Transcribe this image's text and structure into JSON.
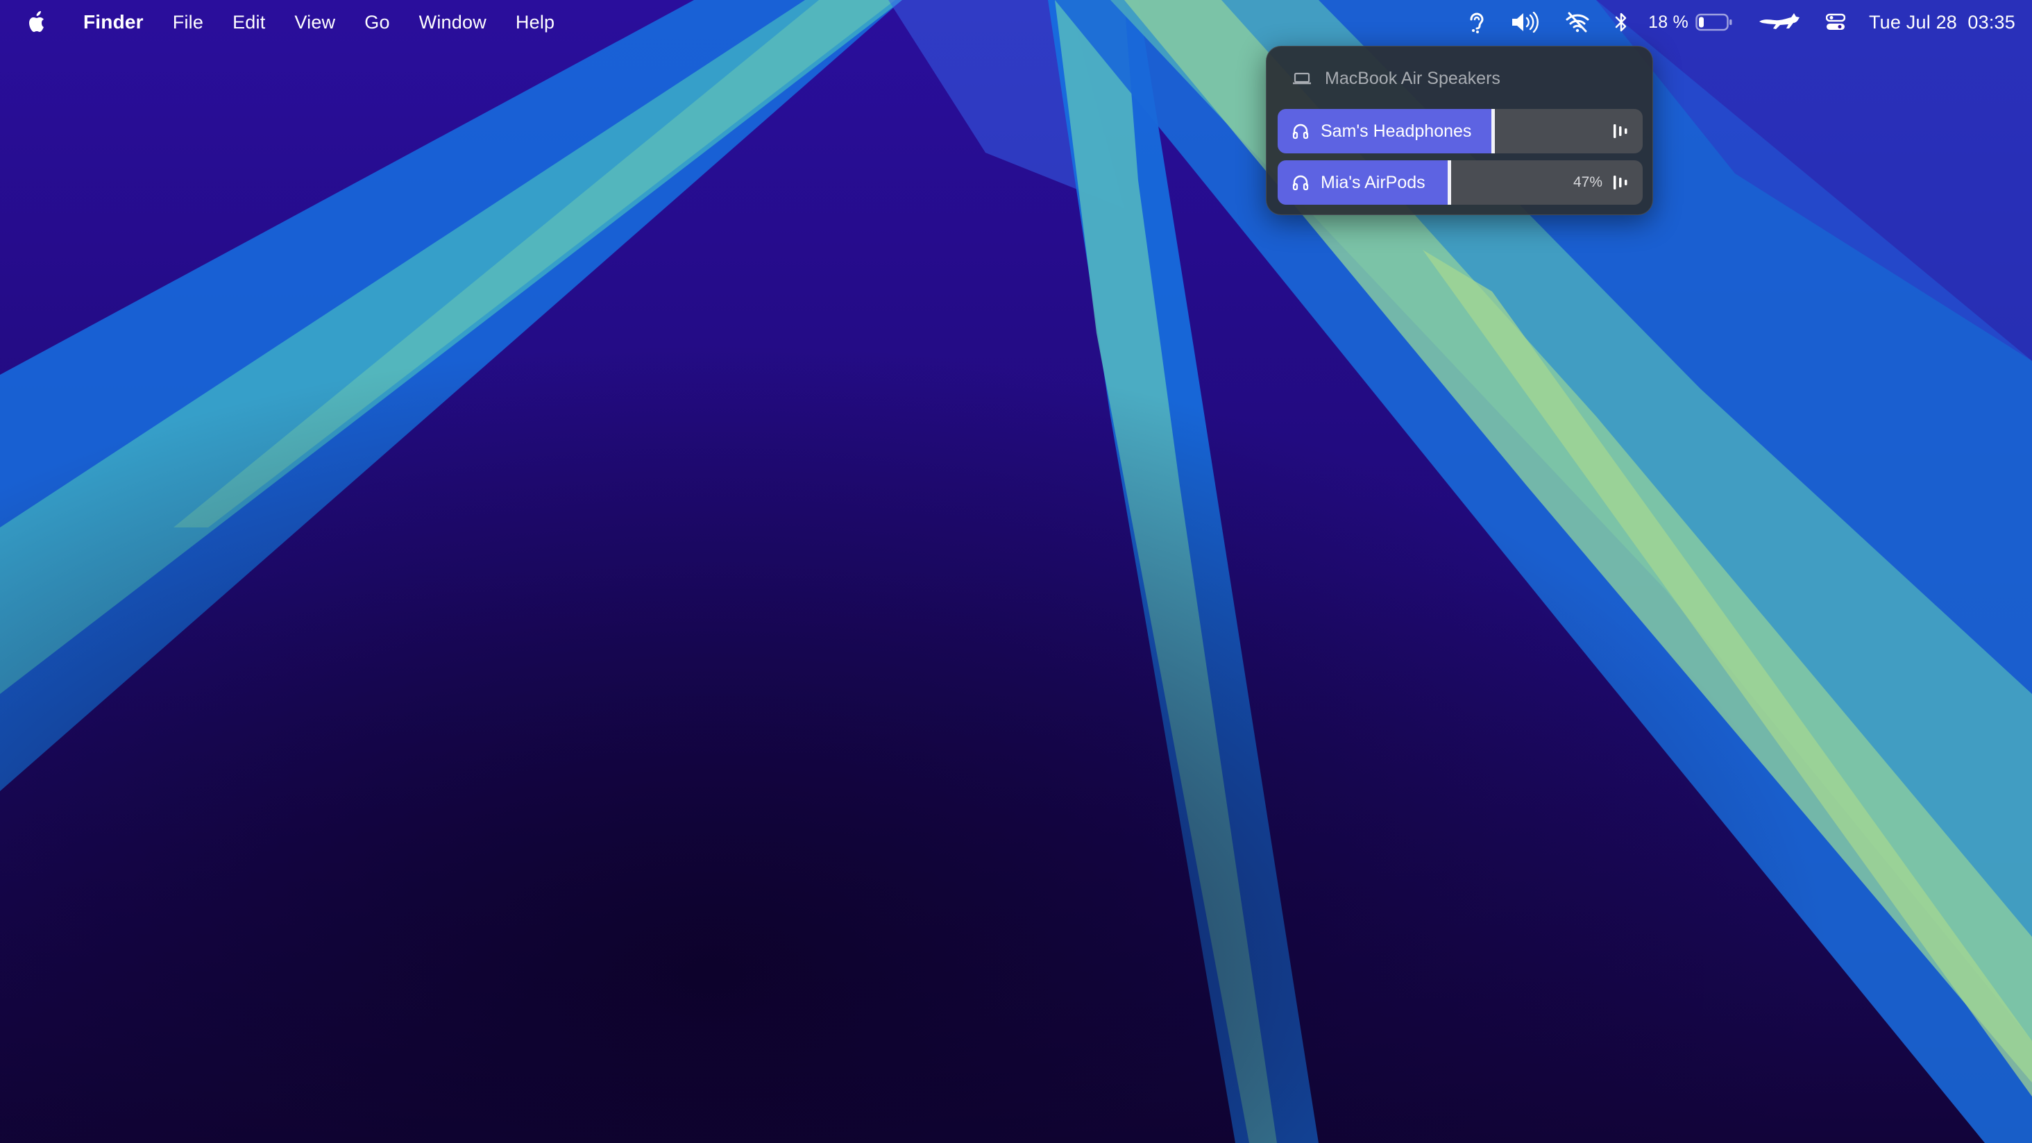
{
  "menubar": {
    "app_name": "Finder",
    "menus": [
      "File",
      "Edit",
      "View",
      "Go",
      "Window",
      "Help"
    ],
    "status_icons": [
      "hearing-icon",
      "volume-icon",
      "wifi-off-icon",
      "bluetooth-icon"
    ],
    "battery_percent": "18 %",
    "battery_level": 0.18,
    "extra_icons": [
      "running-cat-icon",
      "control-center-icon"
    ],
    "datetime": "Tue Jul 28  03:35"
  },
  "audio_popover": {
    "header_label": "MacBook Air Speakers",
    "header_icon": "laptop-icon",
    "outputs": [
      {
        "label": "Sam's Headphones",
        "icon": "headphones-icon",
        "volume": 0.59,
        "percent_label": "",
        "meter_icon": "level-bars-icon"
      },
      {
        "label": "Mia's AirPods",
        "icon": "headphones-icon",
        "volume": 0.47,
        "percent_label": "47%",
        "meter_icon": "level-bars-icon"
      }
    ]
  },
  "colors": {
    "slider_fill": "#5d63e2",
    "popover_bg": "#2a2e34",
    "wallpaper_base": "#1a0650"
  }
}
